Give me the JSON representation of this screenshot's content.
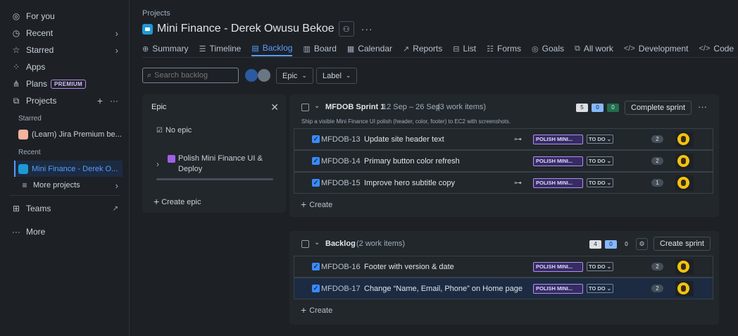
{
  "sidebar": {
    "items": [
      {
        "label": "For you"
      },
      {
        "label": "Recent"
      },
      {
        "label": "Starred"
      },
      {
        "label": "Apps"
      },
      {
        "label": "Plans",
        "badge": "PREMIUM"
      },
      {
        "label": "Projects"
      }
    ],
    "starred_heading": "Starred",
    "starred_project": "(Learn) Jira Premium be...",
    "recent_heading": "Recent",
    "recent_project": "Mini Finance - Derek O...",
    "more_projects": "More projects",
    "teams": "Teams",
    "more": "More"
  },
  "header": {
    "breadcrumb": "Projects",
    "title": "Mini Finance - Derek Owusu Bekoe"
  },
  "tabs": [
    {
      "label": "Summary",
      "icon": "globe-icon"
    },
    {
      "label": "Timeline",
      "icon": "timeline-icon"
    },
    {
      "label": "Backlog",
      "icon": "backlog-icon"
    },
    {
      "label": "Board",
      "icon": "board-icon"
    },
    {
      "label": "Calendar",
      "icon": "calendar-icon"
    },
    {
      "label": "Reports",
      "icon": "chart-icon"
    },
    {
      "label": "List",
      "icon": "list-icon"
    },
    {
      "label": "Forms",
      "icon": "forms-icon"
    },
    {
      "label": "Goals",
      "icon": "target-icon"
    },
    {
      "label": "All work",
      "icon": "stack-icon"
    },
    {
      "label": "Development",
      "icon": "code-icon"
    },
    {
      "label": "Code",
      "icon": "code-icon"
    }
  ],
  "toolbar": {
    "search_placeholder": "Search backlog",
    "epic_filter": "Epic",
    "label_filter": "Label"
  },
  "epic_panel": {
    "heading": "Epic",
    "no_epic": "No epic",
    "epic_name": "Polish Mini Finance UI & Deploy",
    "create_epic": "Create epic"
  },
  "sprint": {
    "name": "MFDOB Sprint 1",
    "dates": "12 Sep – 26 Sep",
    "count": "(3 work items)",
    "goal": "Ship a visible Mini Finance UI polish (header, color, footer) to EC2 with screenshots.",
    "todo": "5",
    "inprogress": "0",
    "done": "0",
    "action": "Complete sprint",
    "create": "Create",
    "items": [
      {
        "key": "MFDOB-13",
        "summary": "Update site header text",
        "label": "POLISH MINI...",
        "status": "TO DO",
        "estimate": "2"
      },
      {
        "key": "MFDOB-14",
        "summary": "Primary button color refresh",
        "label": "POLISH MINI...",
        "status": "TO DO",
        "estimate": "2"
      },
      {
        "key": "MFDOB-15",
        "summary": "Improve hero subtitle copy",
        "label": "POLISH MINI...",
        "status": "TO DO",
        "estimate": "1"
      }
    ]
  },
  "backlog": {
    "name": "Backlog",
    "count": "(2 work items)",
    "todo": "4",
    "inprogress": "0",
    "done": "0",
    "action": "Create sprint",
    "create": "Create",
    "items": [
      {
        "key": "MFDOB-16",
        "summary": "Footer with version & date",
        "label": "POLISH MINI...",
        "status": "TO DO",
        "estimate": "2"
      },
      {
        "key": "MFDOB-17",
        "summary": "Change “Name, Email, Phone” on Home page",
        "label": "POLISH MINI...",
        "status": "TO DO",
        "estimate": "2"
      }
    ]
  },
  "colors": {
    "accent": "#579dff",
    "label_purple": "#b58cf0",
    "bg": "#1d2125",
    "panel": "#22272b"
  }
}
